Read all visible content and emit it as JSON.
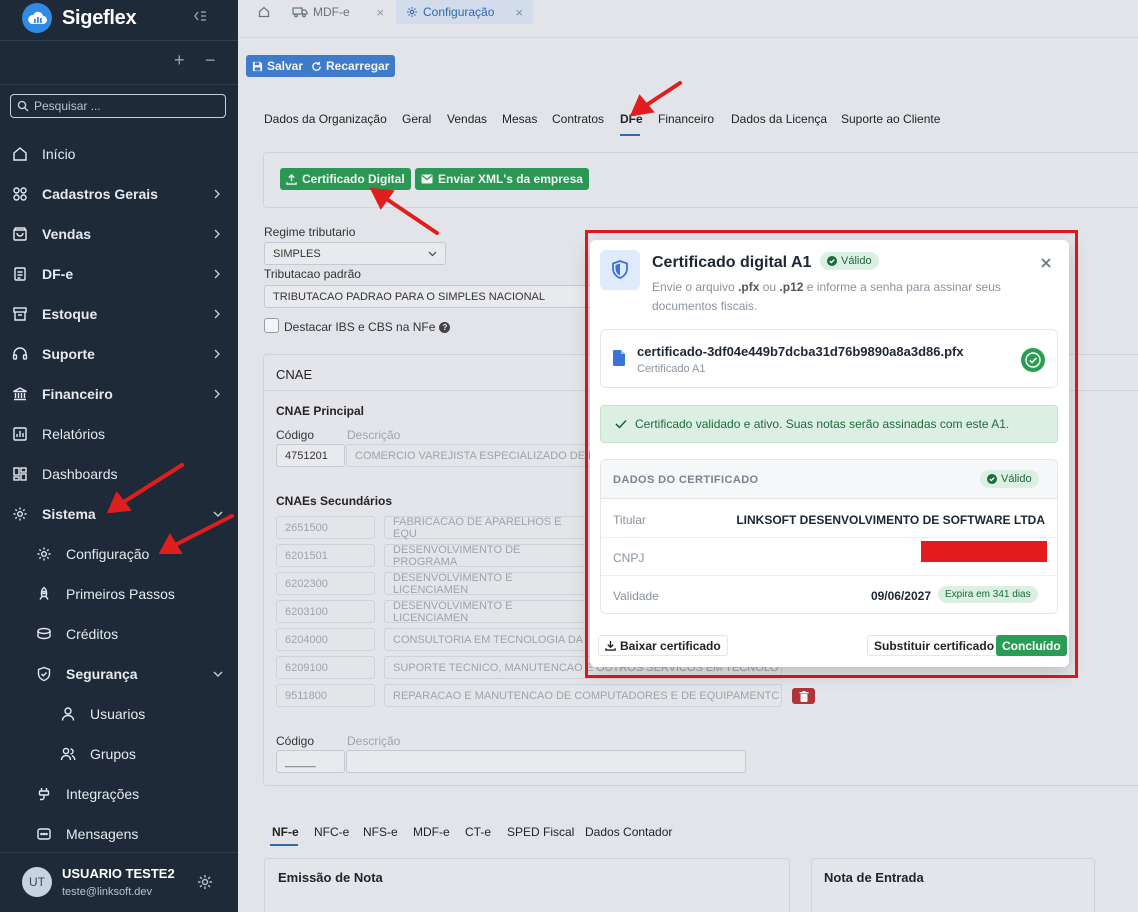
{
  "brand": {
    "name": "Sigeflex"
  },
  "search": {
    "placeholder": "Pesquisar ..."
  },
  "nav": {
    "inicio": "Início",
    "cadastros": "Cadastros Gerais",
    "vendas": "Vendas",
    "dfe": "DF-e",
    "estoque": "Estoque",
    "suporte": "Suporte",
    "financeiro": "Financeiro",
    "relatorios": "Relatórios",
    "dashboards": "Dashboards",
    "sistema": "Sistema",
    "configuracao": "Configuração",
    "primeiros": "Primeiros Passos",
    "creditos": "Créditos",
    "seguranca": "Segurança",
    "usuarios": "Usuarios",
    "grupos": "Grupos",
    "integracoes": "Integrações",
    "mensagens": "Mensagens"
  },
  "user": {
    "initials": "UT",
    "name": "USUARIO TESTE2",
    "email": "teste@linksoft.dev"
  },
  "tabs": {
    "mdfe": "MDF-e",
    "config": "Configuração"
  },
  "toolbar": {
    "save": "Salvar",
    "reload": "Recarregar"
  },
  "pagetabs": [
    "Dados da Organização",
    "Geral",
    "Vendas",
    "Mesas",
    "Contratos",
    "DFe",
    "Financeiro",
    "Dados da Licença",
    "Suporte ao Cliente"
  ],
  "dfe": {
    "cert_btn": "Certificado Digital",
    "xml_btn": "Enviar XML's da empresa",
    "regime_label": "Regime tributario",
    "regime_value": "SIMPLES",
    "trib_label": "Tributacao padrão",
    "trib_value": "TRIBUTACAO PADRAO PARA O SIMPLES NACIONAL",
    "ibs_label": "Destacar IBS e CBS na NFe"
  },
  "cnae": {
    "title": "CNAE",
    "principal_title": "CNAE Principal",
    "codigo_label": "Código",
    "descricao_label": "Descrição",
    "principal": {
      "code": "4751201",
      "desc": "COMERCIO VAREJISTA ESPECIALIZADO DE EQ"
    },
    "secundarios_title": "CNAEs Secundários",
    "secundarios": [
      {
        "code": "2651500",
        "desc": "FABRICACAO DE APARELHOS E EQU"
      },
      {
        "code": "6201501",
        "desc": "DESENVOLVIMENTO DE PROGRAMA"
      },
      {
        "code": "6202300",
        "desc": "DESENVOLVIMENTO E LICENCIAMEN"
      },
      {
        "code": "6203100",
        "desc": "DESENVOLVIMENTO E LICENCIAMEN"
      },
      {
        "code": "6204000",
        "desc": "CONSULTORIA EM TECNOLOGIA DA"
      },
      {
        "code": "6209100",
        "desc": "SUPORTE TECNICO, MANUTENCAO E OUTROS SERVICOS EM TECNOLO"
      },
      {
        "code": "9511800",
        "desc": "REPARACAO E MANUTENCAO DE COMPUTADORES E DE EQUIPAMENTC"
      }
    ],
    "new_code": "_____"
  },
  "bottomtabs": [
    "NF-e",
    "NFC-e",
    "NFS-e",
    "MDF-e",
    "CT-e",
    "SPED Fiscal",
    "Dados Contador"
  ],
  "bottom": {
    "emissao": "Emissão de Nota",
    "entrada": "Nota de Entrada"
  },
  "modal": {
    "title": "Certificado digital A1",
    "badge": "Válido",
    "sub_a": "Envie o arquivo ",
    "ext1": ".pfx",
    "sub_b": " ou ",
    "ext2": ".p12",
    "sub_c": " e informe a senha para assinar seus documentos fiscais.",
    "file_name": "certificado-3df04e449b7dcba31d76b9890a8a3d86.pfx",
    "file_type": "Certificado A1",
    "success": "Certificado validado e ativo. Suas notas serão assinadas com este A1.",
    "data_title": "DADOS DO CERTIFICADO",
    "data_badge": "Válido",
    "titular_label": "Titular",
    "titular_value": "LINKSOFT DESENVOLVIMENTO DE SOFTWARE LTDA",
    "cnpj_label": "CNPJ",
    "validade_label": "Validade",
    "validade_value": "09/06/2027",
    "expira": "Expira em 341 dias",
    "download": "Baixar certificado",
    "replace": "Substituir certificado",
    "done": "Concluído"
  },
  "colors": {
    "sidebar": "#1e2a38",
    "accent": "#3e7fd1",
    "success": "#2a9d55",
    "danger": "#e0191c"
  }
}
